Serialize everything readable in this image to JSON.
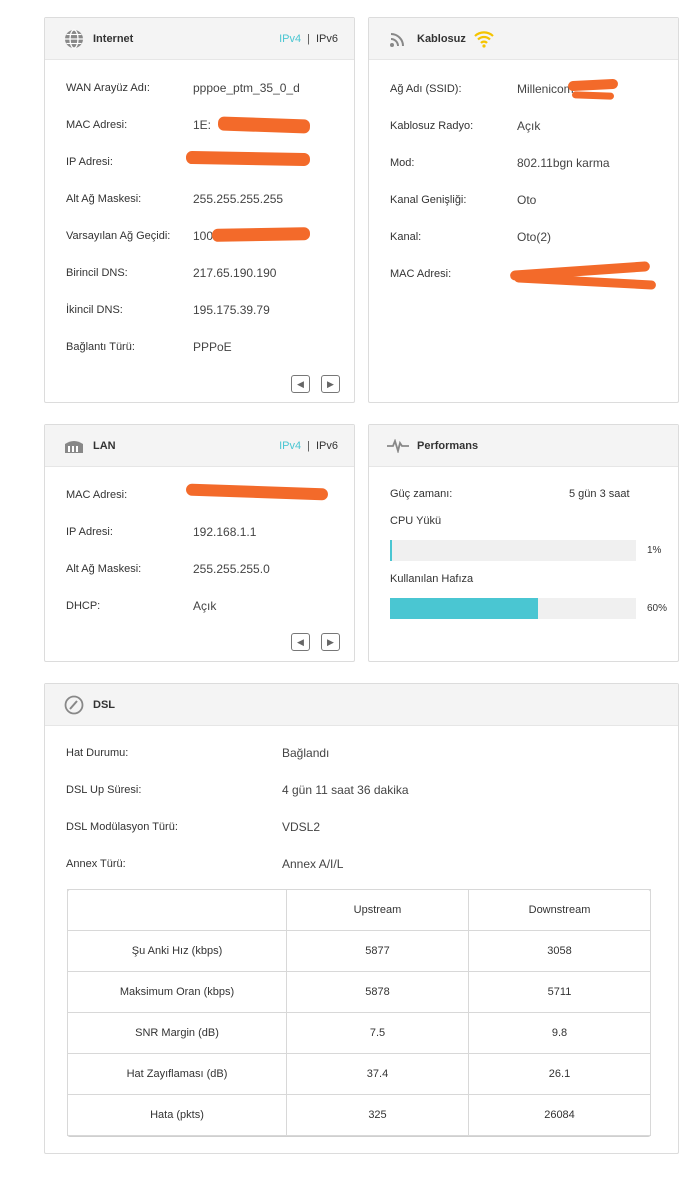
{
  "internet": {
    "title": "Internet",
    "ipv4": "IPv4",
    "ipv6": "IPv6",
    "sep": "|",
    "rows": [
      {
        "label": "WAN Arayüz Adı:",
        "value": "pppoe_ptm_35_0_d"
      },
      {
        "label": "MAC Adresi:",
        "value": "1E:"
      },
      {
        "label": "IP Adresi:",
        "value": ""
      },
      {
        "label": "Alt Ağ Maskesi:",
        "value": "255.255.255.255"
      },
      {
        "label": "Varsayılan Ağ Geçidi:",
        "value": "100"
      },
      {
        "label": "Birincil DNS:",
        "value": "217.65.190.190"
      },
      {
        "label": "İkincil DNS:",
        "value": "195.175.39.79"
      },
      {
        "label": "Bağlantı Türü:",
        "value": "PPPoE"
      }
    ]
  },
  "wireless": {
    "title": "Kablosuz",
    "rows": [
      {
        "label": "Ağ Adı (SSID):",
        "value": "Millenicom"
      },
      {
        "label": "Kablosuz Radyo:",
        "value": "Açık"
      },
      {
        "label": "Mod:",
        "value": "802.11bgn karma"
      },
      {
        "label": "Kanal Genişliği:",
        "value": "Oto"
      },
      {
        "label": "Kanal:",
        "value": "Oto(2)"
      },
      {
        "label": "MAC Adresi:",
        "value": ""
      }
    ]
  },
  "lan": {
    "title": "LAN",
    "ipv4": "IPv4",
    "ipv6": "IPv6",
    "sep": "|",
    "rows": [
      {
        "label": "MAC Adresi:",
        "value": ""
      },
      {
        "label": "IP Adresi:",
        "value": "192.168.1.1"
      },
      {
        "label": "Alt Ağ Maskesi:",
        "value": "255.255.255.0"
      },
      {
        "label": "DHCP:",
        "value": "Açık"
      }
    ]
  },
  "performance": {
    "title": "Performans",
    "uptime_label": "Güç zamanı:",
    "uptime_value": "5 gün 3 saat",
    "cpu_label": "CPU Yükü",
    "cpu_value": "1%",
    "cpu_fraction": 0.01,
    "mem_label": "Kullanılan Hafıza",
    "mem_value": "60%",
    "mem_fraction": 0.6
  },
  "dsl": {
    "title": "DSL",
    "rows": [
      {
        "label": "Hat Durumu:",
        "value": "Bağlandı"
      },
      {
        "label": "DSL Up Süresi:",
        "value": "4 gün 11 saat 36 dakika"
      },
      {
        "label": "DSL Modülasyon Türü:",
        "value": "VDSL2"
      },
      {
        "label": "Annex Türü:",
        "value": "Annex A/I/L"
      }
    ],
    "table": {
      "headers": [
        "",
        "Upstream",
        "Downstream"
      ],
      "rows": [
        [
          "Şu Anki Hız (kbps)",
          "5877",
          "3058"
        ],
        [
          "Maksimum Oran (kbps)",
          "5878",
          "5711"
        ],
        [
          "SNR Margin (dB)",
          "7.5",
          "9.8"
        ],
        [
          "Hat Zayıflaması (dB)",
          "37.4",
          "26.1"
        ],
        [
          "Hata (pkts)",
          "325",
          "26084"
        ]
      ]
    }
  },
  "colors": {
    "accent": "#4ac6d2",
    "redaction": "#f36a2a",
    "wifi_icon": "#f5c400"
  }
}
